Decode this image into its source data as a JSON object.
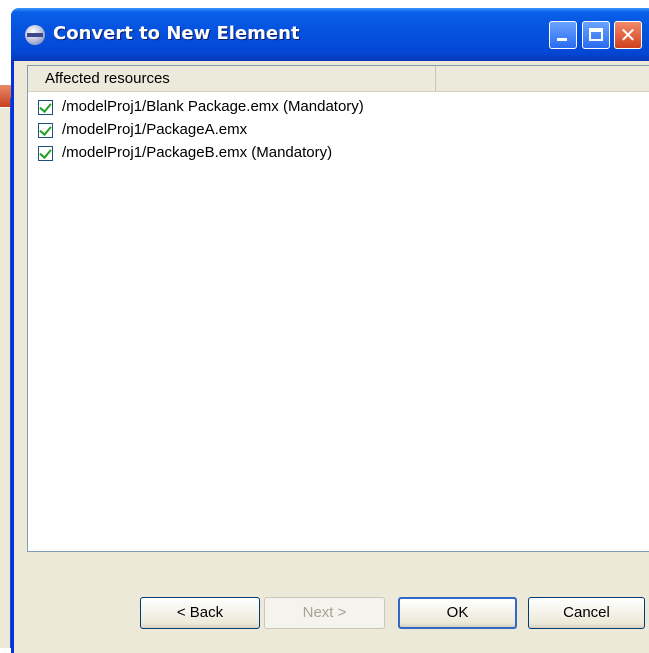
{
  "dialog": {
    "title": "Convert to New Element",
    "title_icon": "eclipse-icon"
  },
  "titlebar_buttons": {
    "minimize_icon": "minimize-icon",
    "maximize_icon": "maximize-icon",
    "close_icon": "close-icon",
    "close_glyph": "✕"
  },
  "table": {
    "column_header": "Affected resources",
    "rows": [
      {
        "label": "/modelProj1/Blank Package.emx (Mandatory)",
        "checked": true
      },
      {
        "label": "/modelProj1/PackageA.emx",
        "checked": true
      },
      {
        "label": "/modelProj1/PackageB.emx (Mandatory)",
        "checked": true
      }
    ]
  },
  "buttons": {
    "back": "< Back",
    "next": "Next >",
    "ok": "OK",
    "cancel": "Cancel"
  },
  "colors": {
    "titlebar": "#0553e0",
    "dialog_bg": "#ece9d8",
    "check": "#21a121"
  }
}
